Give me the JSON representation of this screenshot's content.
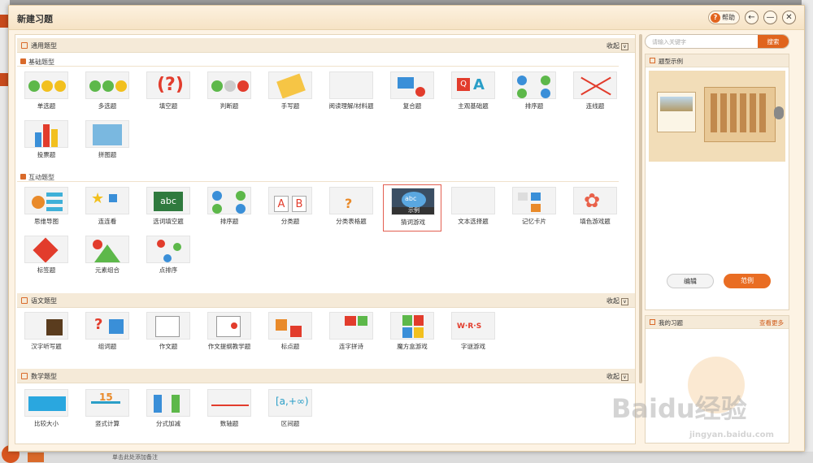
{
  "dialog": {
    "title": "新建习题",
    "help_label": "帮助",
    "back_icon": "←",
    "min_icon": "—",
    "close_icon": "✕"
  },
  "sections": {
    "general": {
      "label": "通用题型",
      "fold": "收起",
      "basic": "基础题型",
      "interactive": "互动题型"
    },
    "chinese": {
      "label": "语文题型",
      "fold": "收起"
    },
    "math": {
      "label": "数学题型",
      "fold": "收起"
    }
  },
  "basic_items": [
    "单选题",
    "多选题",
    "填空题",
    "判断题",
    "手写题",
    "阅读理解/材料题",
    "复合题",
    "主观基础题",
    "排序题",
    "连线题",
    "投票题",
    "拼图题"
  ],
  "interactive_items": [
    "思维导图",
    "连连看",
    "选词填空题",
    "排序题",
    "分类题",
    "分类表格题",
    "猜词游戏",
    "文本选择题",
    "记忆卡片",
    "填色游戏题",
    "标签题",
    "元素组合",
    "点排序"
  ],
  "chinese_items": [
    "汉字听写题",
    "组词题",
    "作文题",
    "作文提纲教学题",
    "标点题",
    "连字拼诗",
    "魔方盒游戏",
    "字谜游戏"
  ],
  "math_items": [
    "比较大小",
    "竖式计算",
    "分式加减",
    "数轴题",
    "区间题"
  ],
  "selected_overlay": "示例",
  "right": {
    "search_placeholder": "请输入关键字",
    "search_button": "搜索",
    "example_title": "题型示例",
    "edit": "编辑",
    "example": "范例",
    "my_title": "我的习题",
    "more": "查看更多"
  },
  "bg": {
    "bottom_note": "单击此处添加备注",
    "watermark": "Baidu经验",
    "watermark_url": "jingyan.baidu.com"
  },
  "colors": {
    "accent": "#e0641d",
    "section_bg": "#f5ead8",
    "green": "#5db84a",
    "blue": "#3a8fd8",
    "red": "#e23c2c"
  }
}
